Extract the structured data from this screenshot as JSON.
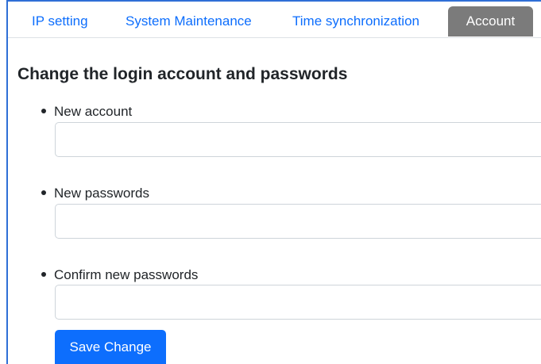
{
  "tabs": [
    {
      "label": "IP setting",
      "active": false
    },
    {
      "label": "System Maintenance",
      "active": false
    },
    {
      "label": "Time synchronization",
      "active": false
    },
    {
      "label": "Account",
      "active": true
    }
  ],
  "page": {
    "title": "Change the login account and passwords"
  },
  "fields": [
    {
      "label": "New account",
      "value": ""
    },
    {
      "label": "New passwords",
      "value": ""
    },
    {
      "label": "Confirm new passwords",
      "value": ""
    }
  ],
  "actions": {
    "save_label": "Save Change"
  },
  "colors": {
    "accent": "#0d6efd",
    "active_tab_bg": "#7b7b7b",
    "frame": "#2f6fd6"
  }
}
